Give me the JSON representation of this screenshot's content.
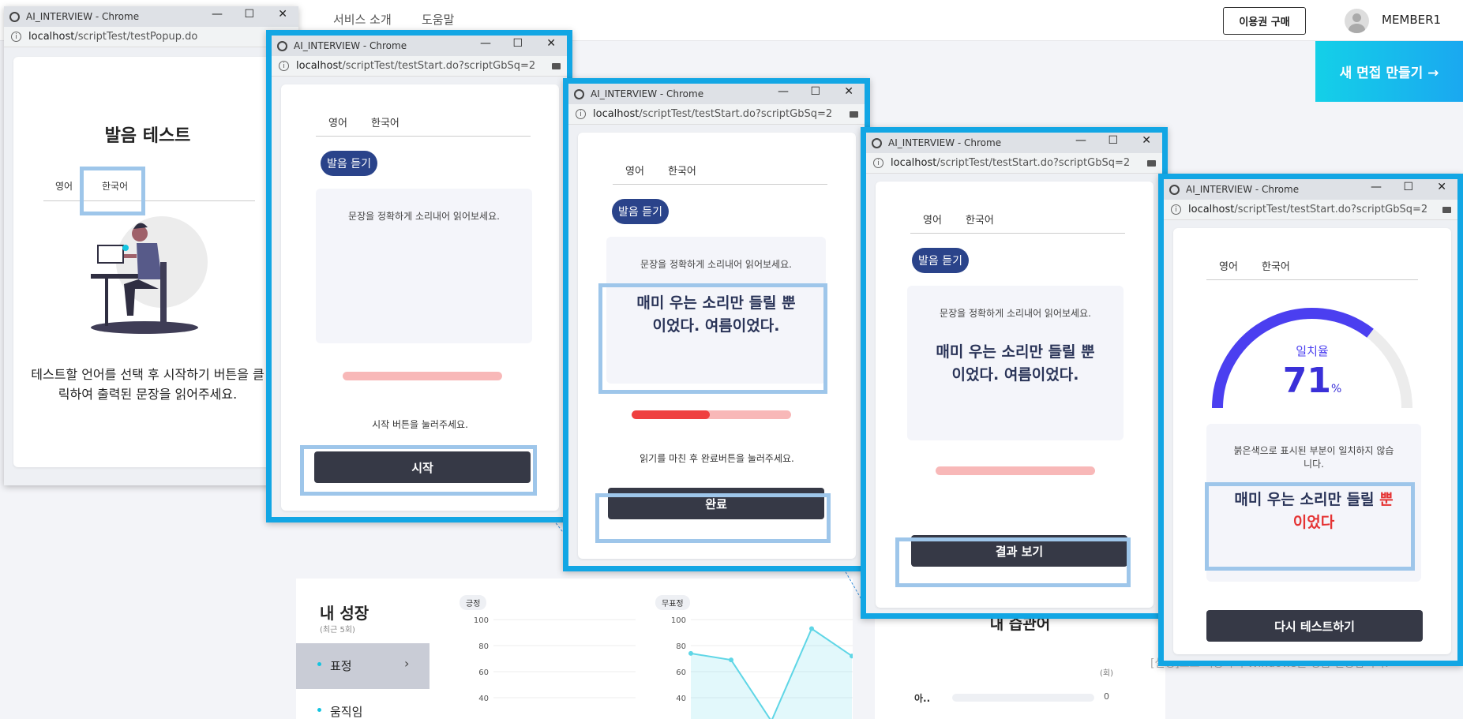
{
  "site": {
    "nav": [
      "서비스 소개",
      "도움말"
    ],
    "ticket_button": "이용권 구매",
    "username": "MEMBER1",
    "new_interview": "새 면접 만들기 →",
    "growth_title": "내 성장",
    "growth_sub": "(최근 5회)",
    "growth_items": [
      "표정",
      "움직임"
    ],
    "chart_tags": [
      "긍정",
      "무표정"
    ],
    "chart_ticks": [
      "100",
      "80",
      "60",
      "40"
    ],
    "habit_title": "내 습관어",
    "habit_unit": "(회)",
    "habit_word": "아..",
    "habit_count": "0",
    "activation": "[설정]으로 이동하여 Windows를 정품 인증합니다."
  },
  "chart_data": {
    "type": "area",
    "title": "무표정",
    "ylim": [
      0,
      100
    ],
    "yticks": [
      100,
      80,
      60,
      40
    ],
    "series": [
      {
        "values": [
          74,
          69,
          22,
          93,
          72
        ]
      }
    ]
  },
  "windows": {
    "title": "AI_INTERVIEW - Chrome",
    "controls": {
      "minimize": "—",
      "maximize": "☐",
      "close": "✕"
    },
    "popup": {
      "url_host": "localhost",
      "url_path": "/scriptTest/testPopup.do",
      "heading": "발음 테스트",
      "tabs": [
        "영어",
        "한국어"
      ],
      "instruction": "테스트할 언어를 선택 후 시작하기 버튼을 클릭하여 출력된 문장을 읽어주세요."
    },
    "step_url_host": "localhost",
    "step_url_path": "/scriptTest/testStart.do?scriptGbSq=2",
    "tabs": [
      "영어",
      "한국어"
    ],
    "listen_button": "발음 듣기",
    "guide": "문장을 정확하게 소리내어 읽어보세요.",
    "sentence": "매미 우는 소리만 들릴 뿐 이었다. 여름이었다.",
    "step1": {
      "hint": "시작 버튼을 눌러주세요.",
      "button": "시작",
      "progress": 0
    },
    "step2": {
      "hint": "읽기를 마친 후 완료버튼을 눌러주세요.",
      "button": "완료",
      "progress": 0.49
    },
    "step3": {
      "button": "결과 보기",
      "progress": 0
    },
    "result": {
      "label": "일치율",
      "score": "71",
      "unit": "%",
      "score_value": 71,
      "gauge_color": "#4b3ff0",
      "mismatch_note": "붉은색으로 표시된 부분이 일치하지 않습니다.",
      "matched_text": "매미 우는 소리만 들릴",
      "mismatch_1": "뿐",
      "mismatch_2": "이었다",
      "retry_button": "다시 테스트하기"
    }
  }
}
